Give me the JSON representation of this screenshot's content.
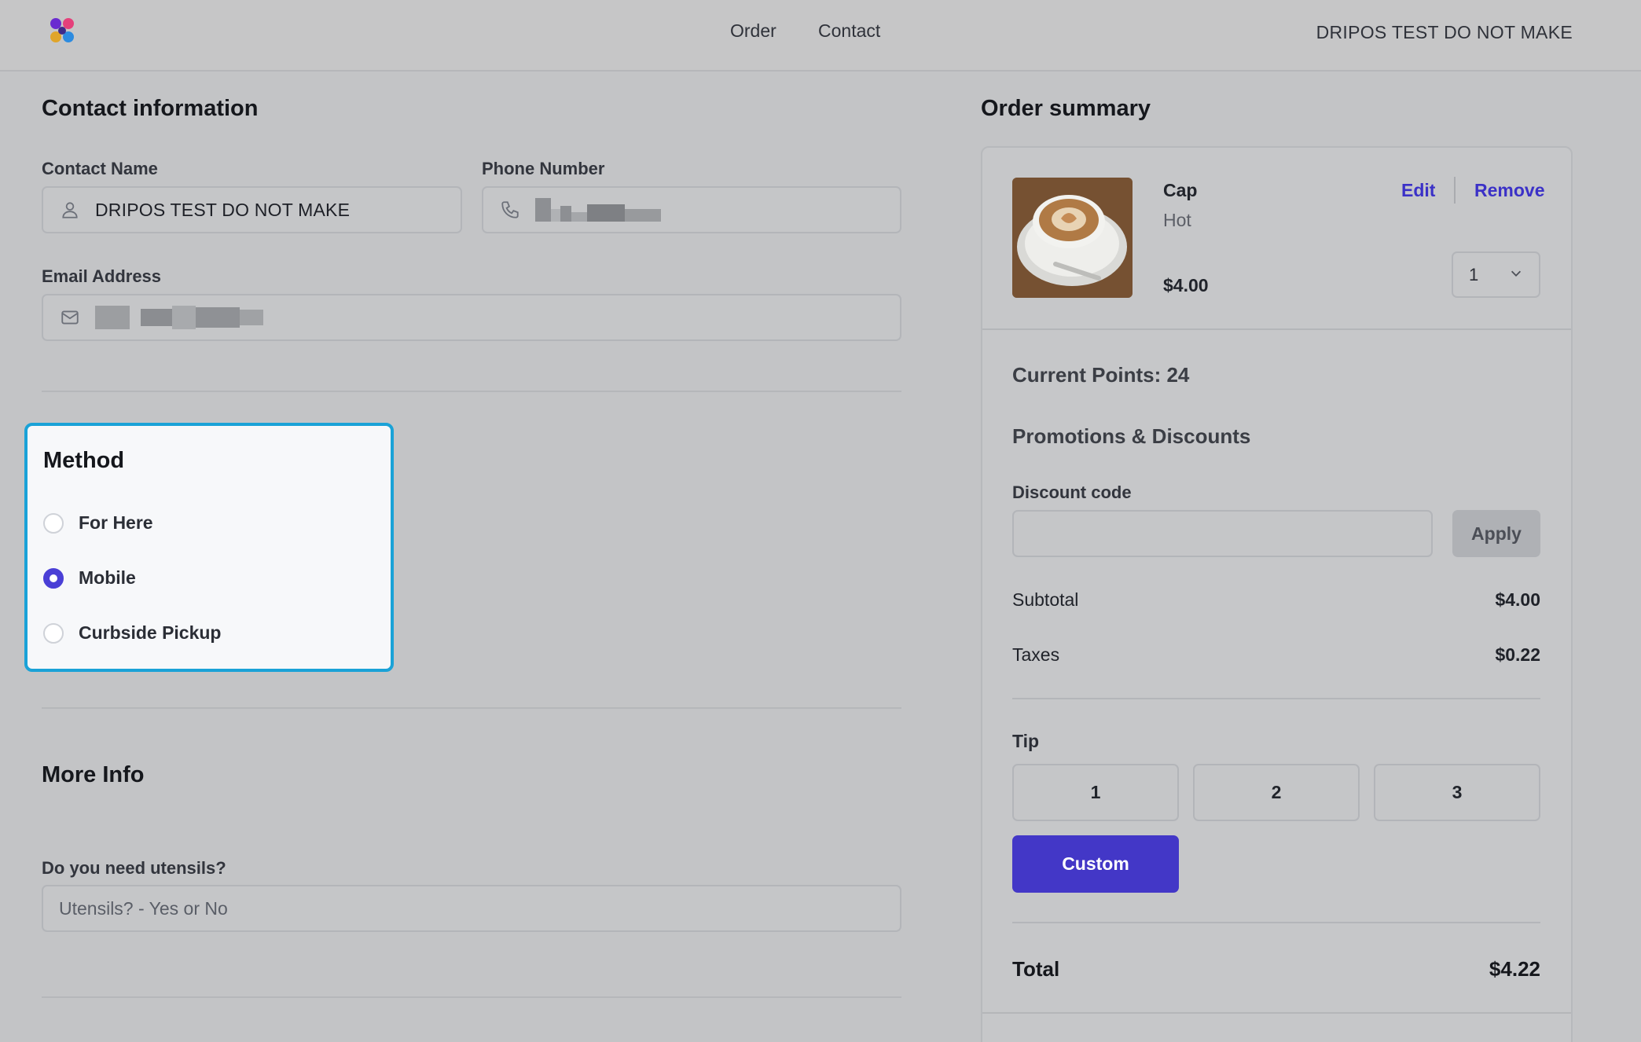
{
  "header": {
    "nav": [
      "Order",
      "Contact"
    ],
    "account_name": "DRIPOS TEST DO NOT MAKE"
  },
  "contact": {
    "title": "Contact information",
    "name_label": "Contact Name",
    "name_value": "DRIPOS TEST DO NOT MAKE",
    "name_icon": "user-icon",
    "phone_label": "Phone Number",
    "phone_icon": "phone-icon",
    "email_label": "Email Address",
    "email_icon": "mail-icon"
  },
  "method": {
    "title": "Method",
    "options": [
      "For Here",
      "Mobile",
      "Curbside Pickup"
    ],
    "selected": "Mobile"
  },
  "more_info": {
    "title": "More Info",
    "utensils_label": "Do you need utensils?",
    "utensils_placeholder": "Utensils? - Yes or No"
  },
  "summary": {
    "title": "Order summary",
    "item": {
      "name": "Cap",
      "variant": "Hot",
      "price": "$4.00",
      "edit_label": "Edit",
      "remove_label": "Remove",
      "quantity": "1"
    },
    "points": "Current Points: 24",
    "promotions_title": "Promotions & Discounts",
    "discount_label": "Discount code",
    "apply_label": "Apply",
    "subtotal_label": "Subtotal",
    "subtotal_value": "$4.00",
    "taxes_label": "Taxes",
    "taxes_value": "$0.22",
    "tip_label": "Tip",
    "tip_options": [
      "1",
      "2",
      "3"
    ],
    "custom_label": "Custom",
    "total_label": "Total",
    "total_value": "$4.22"
  },
  "colors": {
    "accent": "#4337c7",
    "focus_ring": "#1aa2d7",
    "background": "#c3c4c6"
  }
}
